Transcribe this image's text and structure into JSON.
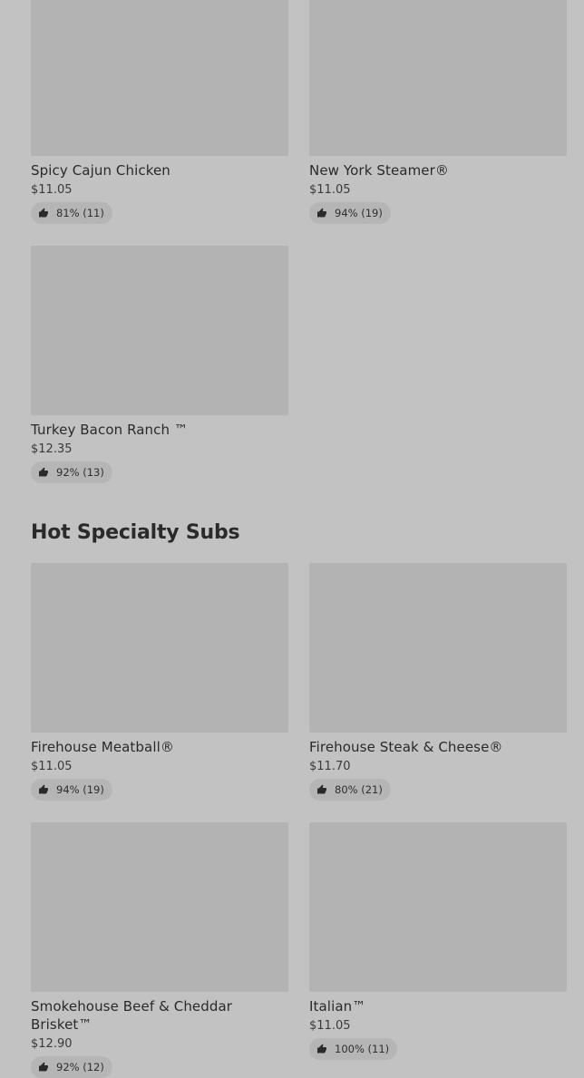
{
  "items_top": [
    {
      "name": "Spicy Cajun Chicken",
      "price": "$11.05",
      "rating": "81% (11)"
    },
    {
      "name": "New York Steamer®",
      "price": "$11.05",
      "rating": "94% (19)"
    },
    {
      "name": "Turkey Bacon Ranch ™",
      "price": "$12.35",
      "rating": "92% (13)"
    }
  ],
  "section": {
    "title": "Hot Specialty Subs"
  },
  "items_hot": [
    {
      "name": "Firehouse Meatball®",
      "price": "$11.05",
      "rating": "94% (19)"
    },
    {
      "name": "Firehouse Steak & Cheese®",
      "price": "$11.70",
      "rating": "80% (21)"
    },
    {
      "name": "Smokehouse Beef & Cheddar Brisket™",
      "price": "$12.90",
      "rating": "92% (12)"
    },
    {
      "name": "Italian™",
      "price": "$11.05",
      "rating": "100% (11)"
    }
  ],
  "icons": {
    "rating": "thumbs-up-icon"
  }
}
